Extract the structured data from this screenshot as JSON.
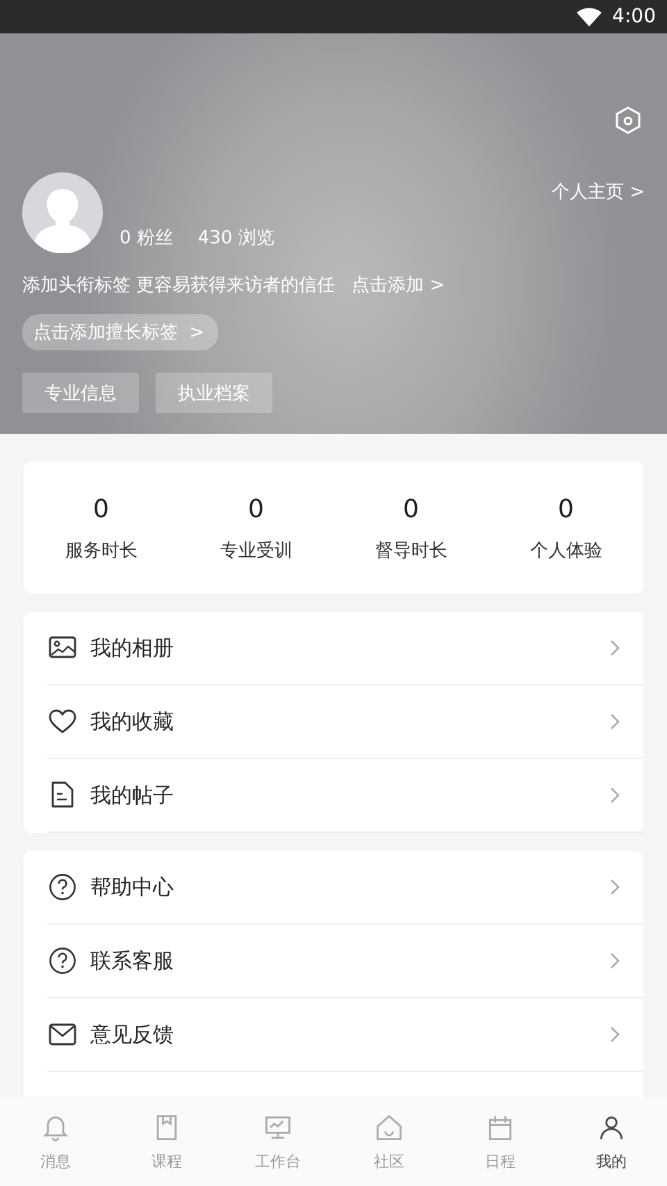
{
  "status_bar": {
    "time": "4:00"
  },
  "profile": {
    "fans": "0 粉丝",
    "views": "430 浏览",
    "home_link": "个人主页 >",
    "title_hint": "添加头衔标签 更容易获得来访者的信任",
    "title_add": "点击添加 >",
    "skill_tag": "点击添加擅长标签  >",
    "buttons": [
      "专业信息",
      "执业档案"
    ]
  },
  "stats": [
    {
      "value": "0",
      "label": "服务时长"
    },
    {
      "value": "0",
      "label": "专业受训"
    },
    {
      "value": "0",
      "label": "督导时长"
    },
    {
      "value": "0",
      "label": "个人体验"
    }
  ],
  "menu_groups": [
    [
      {
        "kind": "album",
        "label": "我的相册"
      },
      {
        "kind": "favorite",
        "label": "我的收藏"
      },
      {
        "kind": "post",
        "label": "我的帖子"
      }
    ],
    [
      {
        "kind": "help",
        "label": "帮助中心"
      },
      {
        "kind": "help",
        "label": "联系客服"
      },
      {
        "kind": "mail",
        "label": "意见反馈"
      }
    ]
  ],
  "tab_bar": [
    {
      "kind": "bell",
      "label": "消息",
      "selected": false
    },
    {
      "kind": "book",
      "label": "课程",
      "selected": false
    },
    {
      "kind": "monitor",
      "label": "工作台",
      "selected": false
    },
    {
      "kind": "home",
      "label": "社区",
      "selected": false
    },
    {
      "kind": "calendar",
      "label": "日程",
      "selected": false
    },
    {
      "kind": "person",
      "label": "我的",
      "selected": true
    }
  ]
}
